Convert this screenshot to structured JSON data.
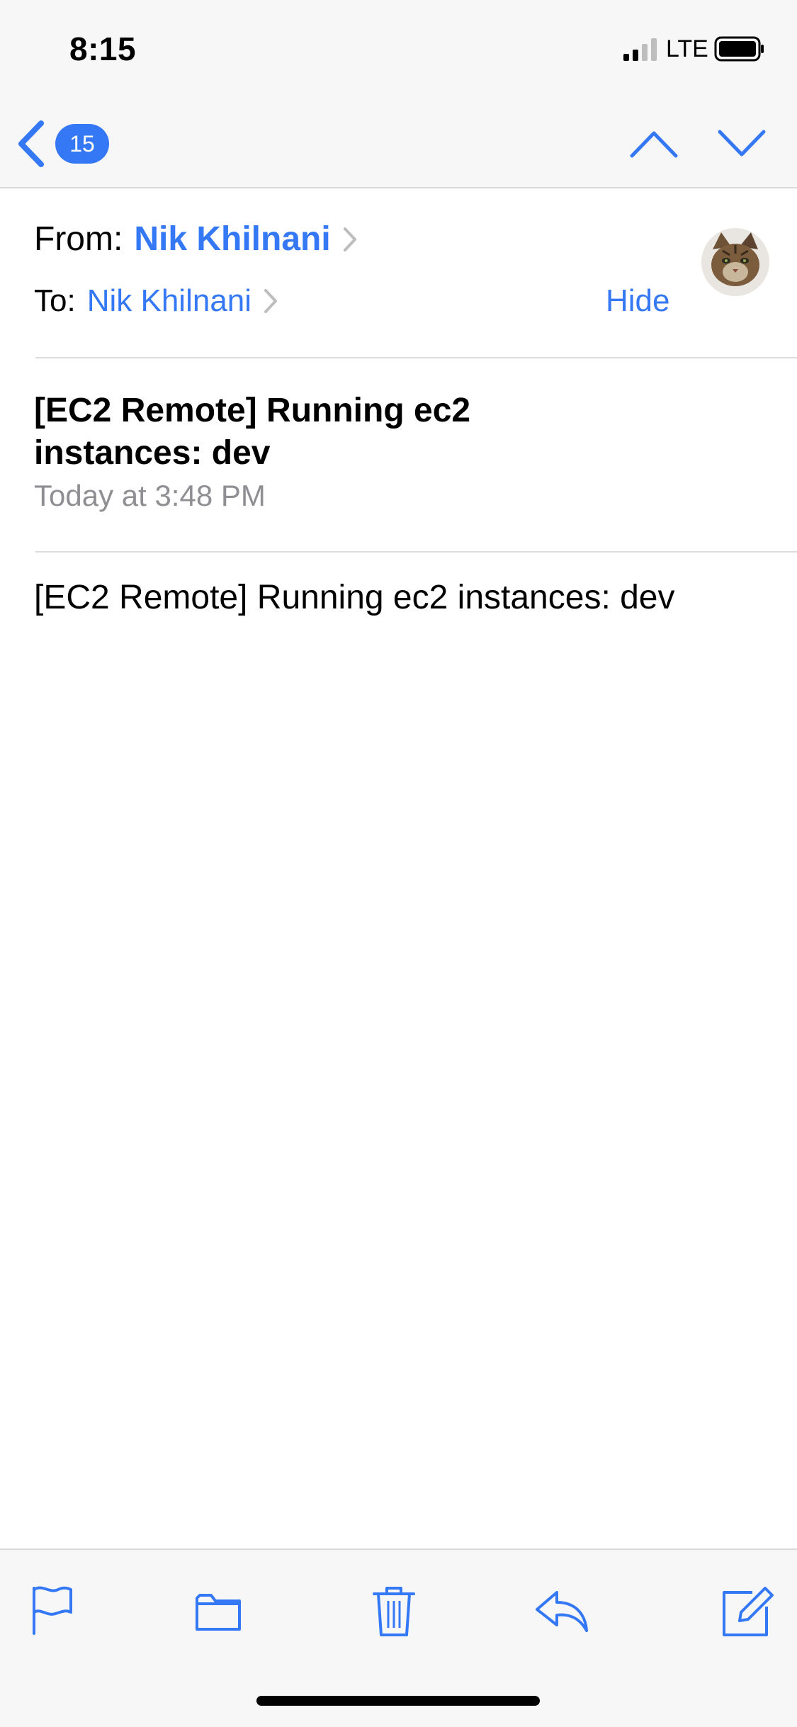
{
  "status_bar": {
    "time": "8:15",
    "network": "LTE"
  },
  "nav": {
    "unread_count": "15"
  },
  "header": {
    "from_label": "From:",
    "from_name": "Nik Khilnani",
    "to_label": "To:",
    "to_name": "Nik Khilnani",
    "hide_label": "Hide"
  },
  "message": {
    "subject": "[EC2 Remote] Running ec2 instances: dev",
    "date": "Today at 3:48 PM",
    "body": "[EC2 Remote] Running ec2 instances: dev"
  },
  "toolbar": {
    "icons": [
      "flag-icon",
      "folder-icon",
      "trash-icon",
      "reply-icon",
      "compose-icon"
    ]
  },
  "colors": {
    "accent": "#3478f6",
    "secondary_text": "#8e8e93",
    "bar_background": "#f7f7f7"
  }
}
